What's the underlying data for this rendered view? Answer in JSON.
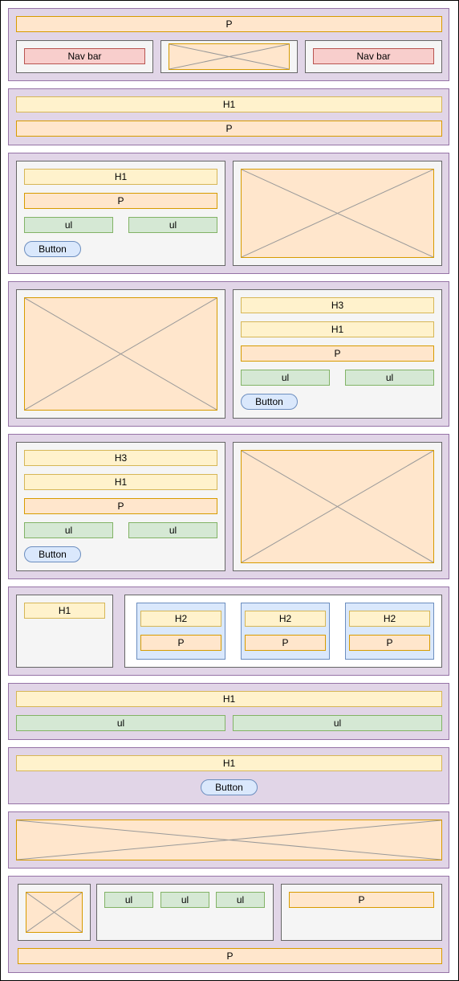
{
  "header": {
    "top_text": "P",
    "nav_left": "Nav bar",
    "nav_right": "Nav bar",
    "logo_icon": "image-placeholder-icon"
  },
  "intro": {
    "heading": "H1",
    "paragraph": "P"
  },
  "feature1": {
    "heading": "H1",
    "paragraph": "P",
    "list1": "ul",
    "list2": "ul",
    "button": "Button"
  },
  "feature2": {
    "subheading": "H3",
    "heading": "H1",
    "paragraph": "P",
    "list1": "ul",
    "list2": "ul",
    "button": "Button"
  },
  "feature3": {
    "subheading": "H3",
    "heading": "H1",
    "paragraph": "P",
    "list1": "ul",
    "list2": "ul",
    "button": "Button"
  },
  "cards": {
    "heading": "H1",
    "items": [
      {
        "title": "H2",
        "text": "P"
      },
      {
        "title": "H2",
        "text": "P"
      },
      {
        "title": "H2",
        "text": "P"
      }
    ]
  },
  "lists": {
    "heading": "H1",
    "list1": "ul",
    "list2": "ul"
  },
  "cta": {
    "heading": "H1",
    "button": "Button"
  },
  "footer": {
    "list1": "ul",
    "list2": "ul",
    "list3": "ul",
    "text": "P",
    "bottom_text": "P"
  }
}
